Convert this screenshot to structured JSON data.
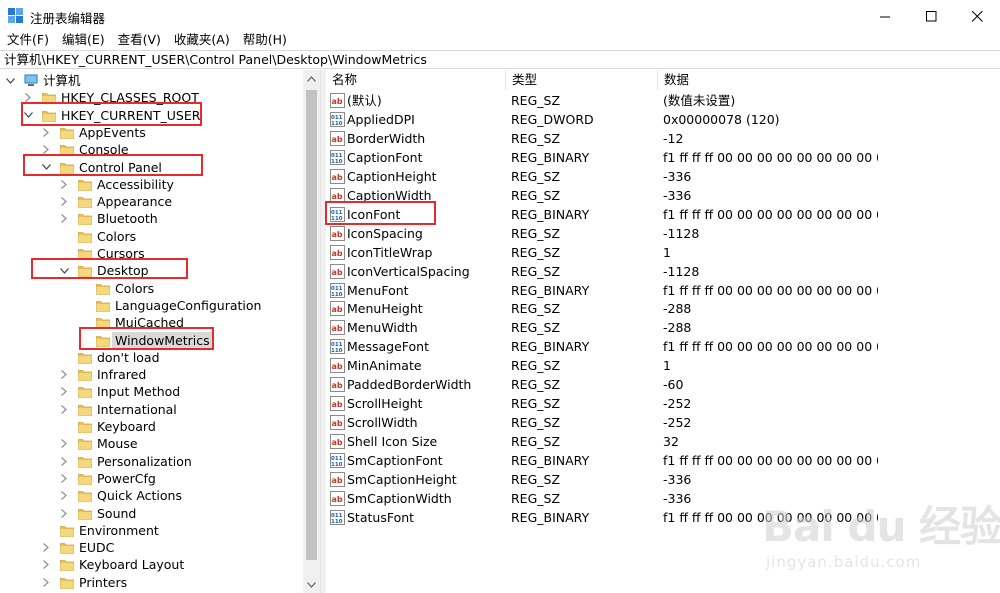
{
  "window": {
    "title": "注册表编辑器",
    "address": "计算机\\HKEY_CURRENT_USER\\Control Panel\\Desktop\\WindowMetrics"
  },
  "menu": [
    "文件(F)",
    "编辑(E)",
    "查看(V)",
    "收藏夹(A)",
    "帮助(H)"
  ],
  "tree": {
    "root": "计算机",
    "items": [
      {
        "label": "HKEY_CLASSES_ROOT",
        "level": 1,
        "expander": "collapsed"
      },
      {
        "label": "HKEY_CURRENT_USER",
        "level": 1,
        "expander": "expanded"
      },
      {
        "label": "AppEvents",
        "level": 2,
        "expander": "collapsed"
      },
      {
        "label": "Console",
        "level": 2,
        "expander": "collapsed"
      },
      {
        "label": "Control Panel",
        "level": 2,
        "expander": "expanded"
      },
      {
        "label": "Accessibility",
        "level": 3,
        "expander": "collapsed"
      },
      {
        "label": "Appearance",
        "level": 3,
        "expander": "collapsed"
      },
      {
        "label": "Bluetooth",
        "level": 3,
        "expander": "collapsed"
      },
      {
        "label": "Colors",
        "level": 3,
        "expander": "none"
      },
      {
        "label": "Cursors",
        "level": 3,
        "expander": "none"
      },
      {
        "label": "Desktop",
        "level": 3,
        "expander": "expanded"
      },
      {
        "label": "Colors",
        "level": 4,
        "expander": "none"
      },
      {
        "label": "LanguageConfiguration",
        "level": 4,
        "expander": "none"
      },
      {
        "label": "MuiCached",
        "level": 4,
        "expander": "none"
      },
      {
        "label": "WindowMetrics",
        "level": 4,
        "expander": "none",
        "selected": true
      },
      {
        "label": "don't load",
        "level": 3,
        "expander": "none"
      },
      {
        "label": "Infrared",
        "level": 3,
        "expander": "collapsed"
      },
      {
        "label": "Input Method",
        "level": 3,
        "expander": "collapsed"
      },
      {
        "label": "International",
        "level": 3,
        "expander": "collapsed"
      },
      {
        "label": "Keyboard",
        "level": 3,
        "expander": "none"
      },
      {
        "label": "Mouse",
        "level": 3,
        "expander": "collapsed"
      },
      {
        "label": "Personalization",
        "level": 3,
        "expander": "collapsed"
      },
      {
        "label": "PowerCfg",
        "level": 3,
        "expander": "collapsed"
      },
      {
        "label": "Quick Actions",
        "level": 3,
        "expander": "collapsed"
      },
      {
        "label": "Sound",
        "level": 3,
        "expander": "collapsed"
      },
      {
        "label": "Environment",
        "level": 2,
        "expander": "none"
      },
      {
        "label": "EUDC",
        "level": 2,
        "expander": "collapsed"
      },
      {
        "label": "Keyboard Layout",
        "level": 2,
        "expander": "collapsed"
      },
      {
        "label": "Printers",
        "level": 2,
        "expander": "collapsed"
      }
    ]
  },
  "list": {
    "columns": [
      "名称",
      "类型",
      "数据"
    ],
    "rows": [
      {
        "name": "(默认)",
        "type": "REG_SZ",
        "data": "(数值未设置)",
        "icon": "string-value-icon"
      },
      {
        "name": "AppliedDPI",
        "type": "REG_DWORD",
        "data": "0x00000078 (120)",
        "icon": "binary-value-icon"
      },
      {
        "name": "BorderWidth",
        "type": "REG_SZ",
        "data": "-12",
        "icon": "string-value-icon"
      },
      {
        "name": "CaptionFont",
        "type": "REG_BINARY",
        "data": "f1 ff ff ff 00 00 00 00 00 00 00 00 00 ...",
        "icon": "binary-value-icon"
      },
      {
        "name": "CaptionHeight",
        "type": "REG_SZ",
        "data": "-336",
        "icon": "string-value-icon"
      },
      {
        "name": "CaptionWidth",
        "type": "REG_SZ",
        "data": "-336",
        "icon": "string-value-icon"
      },
      {
        "name": "IconFont",
        "type": "REG_BINARY",
        "data": "f1 ff ff ff 00 00 00 00 00 00 00 00 00 ...",
        "icon": "binary-value-icon"
      },
      {
        "name": "IconSpacing",
        "type": "REG_SZ",
        "data": "-1128",
        "icon": "string-value-icon"
      },
      {
        "name": "IconTitleWrap",
        "type": "REG_SZ",
        "data": "1",
        "icon": "string-value-icon"
      },
      {
        "name": "IconVerticalSpacing",
        "type": "REG_SZ",
        "data": "-1128",
        "icon": "string-value-icon"
      },
      {
        "name": "MenuFont",
        "type": "REG_BINARY",
        "data": "f1 ff ff ff 00 00 00 00 00 00 00 00 00 ...",
        "icon": "binary-value-icon"
      },
      {
        "name": "MenuHeight",
        "type": "REG_SZ",
        "data": "-288",
        "icon": "string-value-icon"
      },
      {
        "name": "MenuWidth",
        "type": "REG_SZ",
        "data": "-288",
        "icon": "string-value-icon"
      },
      {
        "name": "MessageFont",
        "type": "REG_BINARY",
        "data": "f1 ff ff ff 00 00 00 00 00 00 00 00 00 ...",
        "icon": "binary-value-icon"
      },
      {
        "name": "MinAnimate",
        "type": "REG_SZ",
        "data": "1",
        "icon": "string-value-icon"
      },
      {
        "name": "PaddedBorderWidth",
        "type": "REG_SZ",
        "data": "-60",
        "icon": "string-value-icon"
      },
      {
        "name": "ScrollHeight",
        "type": "REG_SZ",
        "data": "-252",
        "icon": "string-value-icon"
      },
      {
        "name": "ScrollWidth",
        "type": "REG_SZ",
        "data": "-252",
        "icon": "string-value-icon"
      },
      {
        "name": "Shell Icon Size",
        "type": "REG_SZ",
        "data": "32",
        "icon": "string-value-icon"
      },
      {
        "name": "SmCaptionFont",
        "type": "REG_BINARY",
        "data": "f1 ff ff ff 00 00 00 00 00 00 00 00 00 ...",
        "icon": "binary-value-icon"
      },
      {
        "name": "SmCaptionHeight",
        "type": "REG_SZ",
        "data": "-336",
        "icon": "string-value-icon"
      },
      {
        "name": "SmCaptionWidth",
        "type": "REG_SZ",
        "data": "-336",
        "icon": "string-value-icon"
      },
      {
        "name": "StatusFont",
        "type": "REG_BINARY",
        "data": "f1 ff ff ff 00 00 00 00 00 00 00 00 00 ...",
        "icon": "binary-value-icon"
      }
    ]
  },
  "watermark": {
    "logo": "Bai du 经验",
    "url": "jingyan.baidu.com"
  },
  "colors": {
    "annotation": "#e52b2b",
    "folder": "#e8c15a",
    "selection": "#d9d9d9"
  }
}
